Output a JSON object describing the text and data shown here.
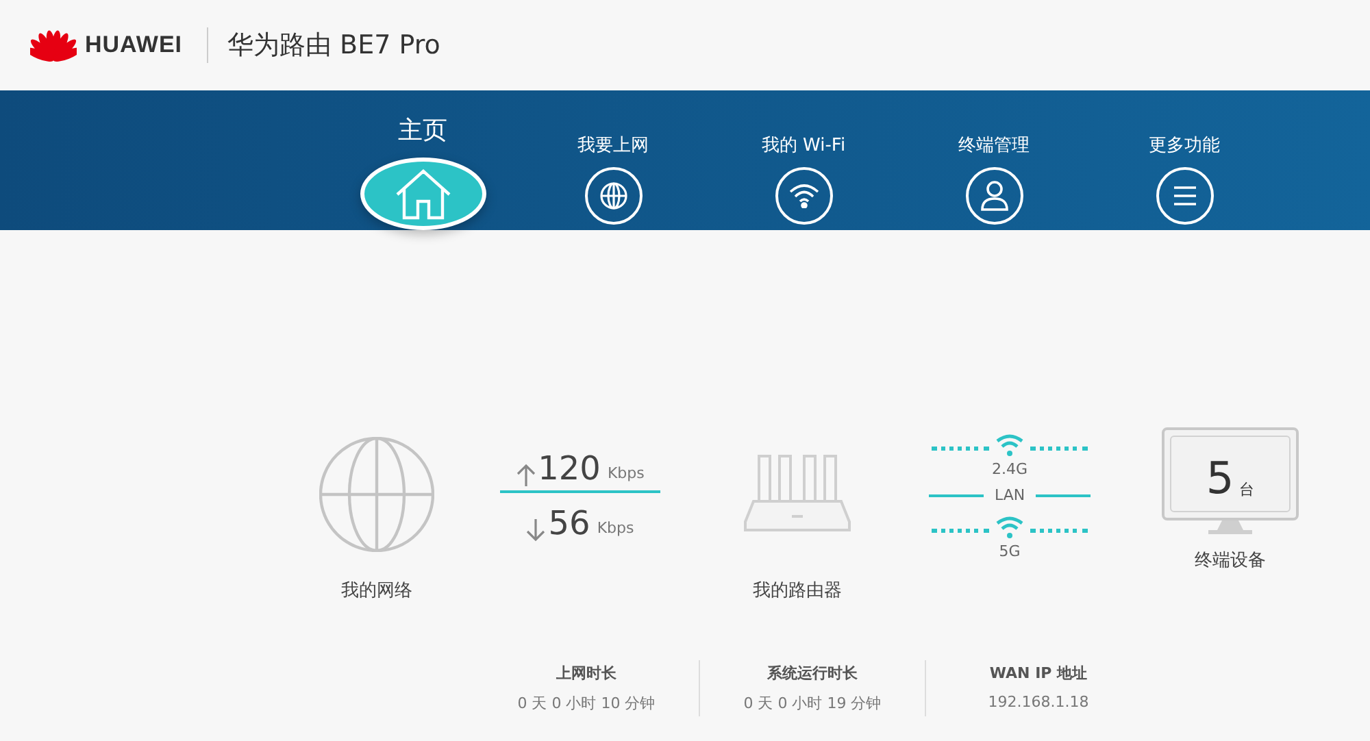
{
  "brand": {
    "name": "HUAWEI",
    "product": "华为路由 BE7 Pro"
  },
  "nav": [
    {
      "label": "主页",
      "selected": true
    },
    {
      "label": "我要上网",
      "selected": false
    },
    {
      "label": "我的 Wi-Fi",
      "selected": false
    },
    {
      "label": "终端管理",
      "selected": false
    },
    {
      "label": "更多功能",
      "selected": false
    }
  ],
  "status": {
    "network_label": "我的网络",
    "upload": {
      "value": "120",
      "unit": "Kbps"
    },
    "download": {
      "value": "56",
      "unit": "Kbps"
    },
    "router_label": "我的路由器",
    "bands": [
      {
        "kind": "wifi",
        "label": "2.4G"
      },
      {
        "kind": "wired",
        "label": "LAN"
      },
      {
        "kind": "wifi",
        "label": "5G"
      }
    ],
    "devices": {
      "count": "5",
      "unit": "台",
      "label": "终端设备"
    }
  },
  "stats": [
    {
      "label": "上网时长",
      "value": "0 天 0 小时 10 分钟"
    },
    {
      "label": "系统运行时长",
      "value": "0 天 0 小时 19 分钟"
    },
    {
      "label": "WAN IP 地址",
      "value": "192.168.1.18"
    }
  ]
}
